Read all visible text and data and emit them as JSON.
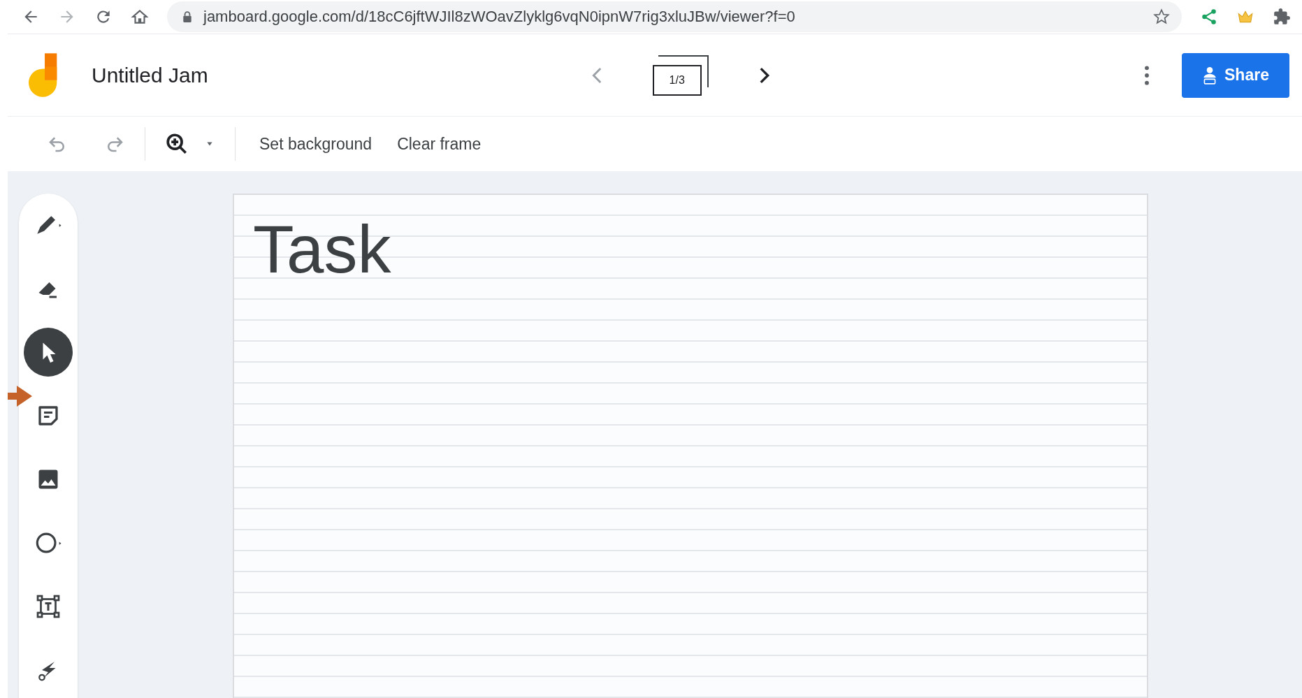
{
  "browser": {
    "url": "jamboard.google.com/d/18cC6jftWJIl8zWOavZlyklg6vqN0ipnW7rig3xluJBw/viewer?f=0"
  },
  "header": {
    "title": "Untitled Jam",
    "frame_counter": "1/3",
    "share_button": "Share"
  },
  "toolbar": {
    "buttons": [
      "Set background",
      "Clear frame"
    ]
  },
  "tools": [
    {
      "kind": "pen",
      "selected": false
    },
    {
      "kind": "eraser",
      "selected": false
    },
    {
      "kind": "select",
      "selected": true
    },
    {
      "kind": "note",
      "selected": false
    },
    {
      "kind": "image",
      "selected": false
    },
    {
      "kind": "circle",
      "selected": false
    },
    {
      "kind": "textbox",
      "selected": false
    },
    {
      "kind": "laser",
      "selected": false
    }
  ],
  "frame": {
    "text": "Task"
  }
}
